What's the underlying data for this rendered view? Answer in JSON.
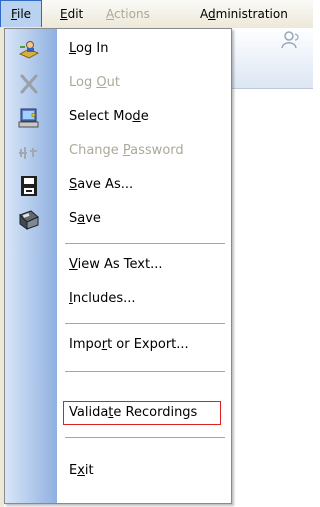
{
  "menubar": {
    "file": {
      "pre": "",
      "ul": "F",
      "post": "ile"
    },
    "edit": {
      "pre": "",
      "ul": "E",
      "post": "dit"
    },
    "actions": {
      "pre": "",
      "ul": "A",
      "post": "ctions"
    },
    "administration": {
      "pre": "A",
      "ul": "d",
      "post": "ministration"
    }
  },
  "menu": {
    "items": [
      {
        "pre": "",
        "ul": "L",
        "post": "og In"
      },
      {
        "pre": "Log ",
        "ul": "O",
        "post": "ut"
      },
      {
        "pre": "Select Mo",
        "ul": "d",
        "post": "e"
      },
      {
        "pre": "Change ",
        "ul": "P",
        "post": "assword"
      },
      {
        "pre": "",
        "ul": "S",
        "post": "ave As..."
      },
      {
        "pre": "S",
        "ul": "a",
        "post": "ve"
      },
      {
        "pre": "",
        "ul": "V",
        "post": "iew As Text..."
      },
      {
        "pre": "",
        "ul": "I",
        "post": "ncludes..."
      },
      {
        "pre": "Impo",
        "ul": "r",
        "post": "t or Export..."
      },
      {
        "pre": "Valida",
        "ul": "t",
        "post": "e Recordings"
      },
      {
        "pre": "E",
        "ul": "x",
        "post": "it"
      }
    ]
  },
  "colors": {
    "gutter_start": "#d8e6f8",
    "gutter_end": "#8fb0e0",
    "active_menu_bg": "#b8d2ef",
    "disabled_text": "#aca899",
    "highlight_border": "#e02020"
  }
}
